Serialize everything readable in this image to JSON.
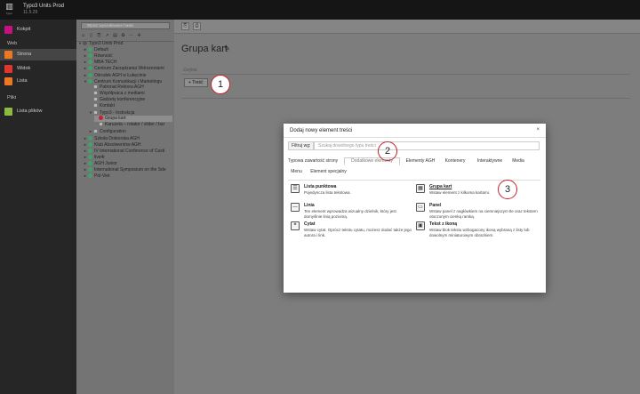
{
  "app": {
    "name": "Typo3 Units Prod",
    "version": "11.5.29",
    "logo_glyph": "▥",
    "logo_text": "typo"
  },
  "modules": [
    {
      "label": "Kokpit",
      "icon": "dashboard-icon",
      "color": "#c6117e"
    },
    {
      "group": "Web"
    },
    {
      "label": "Strona",
      "icon": "page-icon",
      "color": "#ef7721",
      "active": true
    },
    {
      "label": "Widok",
      "icon": "view-icon",
      "color": "#e2352b"
    },
    {
      "label": "Lista",
      "icon": "list-icon",
      "color": "#ef7721"
    },
    {
      "group": "Pliki"
    },
    {
      "label": "Lista plików",
      "icon": "filelist-icon",
      "color": "#8cbc3f"
    }
  ],
  "tree": {
    "filter_placeholder": "Wpisz wyszukiwane hasło",
    "toolbar_icons": [
      "page-new-icon",
      "page-icon",
      "page-external-icon",
      "page-shortcut-icon",
      "page-folder-icon",
      "page-recycler-icon",
      "page-spacer-icon",
      "page-divider-icon"
    ],
    "items": [
      {
        "label": "Typo3 Units Prod",
        "level": 0,
        "toggle": "▼",
        "icon": "globe",
        "color": "#555555"
      },
      {
        "label": "Default",
        "level": 1,
        "toggle": "►",
        "icon": "globe",
        "color": "#3fa36b"
      },
      {
        "label": "Równość",
        "level": 1,
        "toggle": "►",
        "icon": "globe",
        "color": "#3fa36b"
      },
      {
        "label": "MBA TECH",
        "level": 1,
        "toggle": "►",
        "icon": "globe",
        "color": "#3fa36b"
      },
      {
        "label": "Centrum Zarządzania Wdrożeniami",
        "level": 1,
        "toggle": "►",
        "icon": "globe",
        "color": "#3fa36b"
      },
      {
        "label": "Ośrodek AGH w Łukęcinie",
        "level": 1,
        "toggle": "►",
        "icon": "globe",
        "color": "#3fa36b"
      },
      {
        "label": "Centrum Komunikacji i Marketingu",
        "level": 1,
        "toggle": "▼",
        "icon": "globe",
        "color": "#3fa36b"
      },
      {
        "label": "Patronat Rektora AGH",
        "level": 2,
        "toggle": "",
        "icon": "page",
        "color": ""
      },
      {
        "label": "Współpraca z mediami",
        "level": 2,
        "toggle": "",
        "icon": "page",
        "color": ""
      },
      {
        "label": "Gadżety konferencyjne",
        "level": 2,
        "toggle": "",
        "icon": "page",
        "color": ""
      },
      {
        "label": "Kontakt",
        "level": 2,
        "toggle": "",
        "icon": "page",
        "color": ""
      },
      {
        "label": "Typo3 - Instrukcja",
        "level": 2,
        "toggle": "▼",
        "icon": "page",
        "color": ""
      },
      {
        "label": "Grupa kart",
        "level": 3,
        "toggle": "",
        "icon": "globe",
        "color": "#c8202d",
        "selected": true
      },
      {
        "label": "Karuzela – rotator / slider / bar",
        "level": 3,
        "toggle": "",
        "icon": "page",
        "color": ""
      },
      {
        "label": "Configuration",
        "level": 2,
        "toggle": "►",
        "icon": "page",
        "color": ""
      },
      {
        "label": "Szkoła Doktorska AGH",
        "level": 1,
        "toggle": "►",
        "icon": "globe",
        "color": "#3fa36b"
      },
      {
        "label": "Klub Absolwentów AGH",
        "level": 1,
        "toggle": "►",
        "icon": "globe",
        "color": "#3fa36b"
      },
      {
        "label": "IV International Conference of Casti",
        "level": 1,
        "toggle": "►",
        "icon": "globe",
        "color": "#3fa36b"
      },
      {
        "label": "live4r",
        "level": 1,
        "toggle": "►",
        "icon": "globe",
        "color": "#3fa36b"
      },
      {
        "label": "AGH Junior",
        "level": 1,
        "toggle": "►",
        "icon": "globe",
        "color": "#3fa36b"
      },
      {
        "label": "International Symposium on the Sde",
        "level": 1,
        "toggle": "►",
        "icon": "globe",
        "color": "#3fa36b"
      },
      {
        "label": "Pol-Viet",
        "level": 1,
        "toggle": "►",
        "icon": "globe",
        "color": "#3fa36b"
      }
    ]
  },
  "content": {
    "toolbar": {
      "view_icon": "view-page-icon",
      "edit_icon": "edit-page-icon"
    },
    "page_title": "Grupa kart",
    "pencil": "✎",
    "column_label": "Zwykła",
    "add_content_label": "+ Treść"
  },
  "markers": [
    "1",
    "2",
    "3"
  ],
  "modal": {
    "title": "Dodaj nowy element treści",
    "close": "×",
    "filter_label": "Filtruj wg:",
    "filter_placeholder": "Szukaj dowolnego typu treści",
    "tabs": [
      "Typowa zawartość strony",
      "Dodatkowe elementy",
      "Elementy AGH",
      "Kontenery",
      "Interaktywne",
      "Media",
      "Menu",
      "Element specjalny"
    ],
    "active_tab": 1,
    "elements": [
      {
        "title": "Lista punktowa",
        "desc": "Pojedyncza lista tekstowa.",
        "icon": "bullets-icon",
        "glyph": "☰",
        "link": false
      },
      {
        "title": "Grupa kart",
        "desc": "Wstaw element z kilkoma kartami.",
        "icon": "card-group-icon",
        "glyph": "▦",
        "link": true
      },
      {
        "title": "Linia",
        "desc": "Ten element wprowadza wizualny dzielnik, który jest domyślnie linią poziomą.",
        "icon": "divider-icon",
        "glyph": "—",
        "link": false
      },
      {
        "title": "Panel",
        "desc": "Wstaw panel z nagłówkiem na ciemniejszym tle oraz tekstem otoczonym cienką ramką.",
        "icon": "panel-icon",
        "glyph": "▭",
        "link": false
      },
      {
        "title": "Cytat",
        "desc": "Wstaw cytat. Oprócz tekstu cytatu, możesz dodać także jego autora i link.",
        "icon": "quote-icon",
        "glyph": "❝",
        "link": false
      },
      {
        "title": "Tekst z ikoną",
        "desc": "Wstaw blok tekstu wzbogacony ikoną wybraną z listy lub dowolnym miniaturowym obrazkiem.",
        "icon": "text-icon-icon",
        "glyph": "▣",
        "link": false
      }
    ]
  }
}
